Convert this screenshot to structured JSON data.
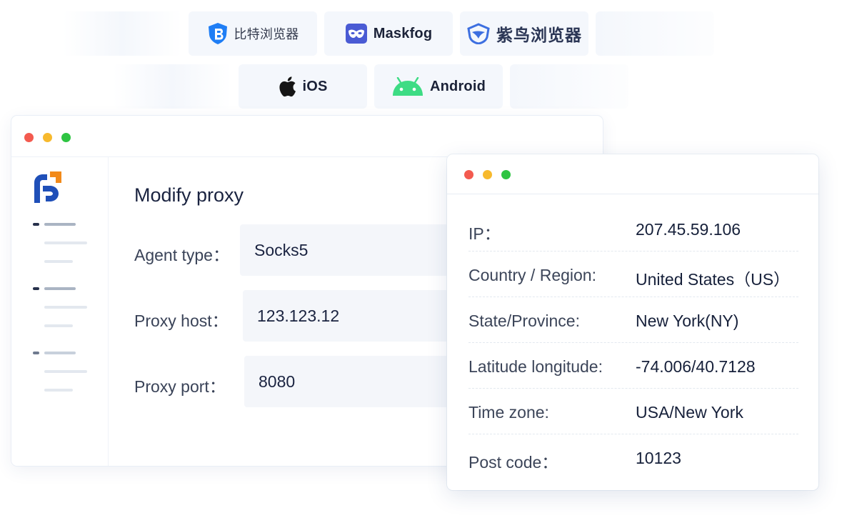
{
  "integrations": {
    "row1": [
      {
        "name": "bitbrowser",
        "label": "比特浏览器",
        "icon": "bitbrowser-shield-icon"
      },
      {
        "name": "maskfog",
        "label": "Maskfog",
        "icon": "maskfog-mask-icon"
      },
      {
        "name": "zuniao",
        "label": "紫鸟浏览器",
        "icon": "zuniao-bird-icon"
      }
    ],
    "row2": [
      {
        "name": "ios",
        "label": "iOS",
        "icon": "apple-icon"
      },
      {
        "name": "android",
        "label": "Android",
        "icon": "android-icon"
      }
    ]
  },
  "main_window": {
    "title": "Modify proxy",
    "fields": [
      {
        "label": "Agent type：",
        "value": "Socks5"
      },
      {
        "label": "Proxy host：",
        "value": "123.123.12"
      },
      {
        "label": "Proxy port：",
        "value": "8080"
      }
    ]
  },
  "info_window": {
    "rows": [
      {
        "key": "IP：",
        "value": "207.45.59.106"
      },
      {
        "key": "Country / Region:",
        "value": "United States（US）"
      },
      {
        "key": "State/Province:",
        "value": "New York(NY)"
      },
      {
        "key": "Latitude longitude:",
        "value": "-74.006/40.7128"
      },
      {
        "key": "Time zone:",
        "value": "USA/New York"
      },
      {
        "key": "Post code：",
        "value": "10123"
      }
    ]
  },
  "colors": {
    "window_red": "#f35a4f",
    "window_yellow": "#f7b92d",
    "window_green": "#2ec442",
    "brand_blue": "#1f4fb8",
    "brand_orange": "#f28a1a",
    "android_green": "#3ddc84"
  }
}
